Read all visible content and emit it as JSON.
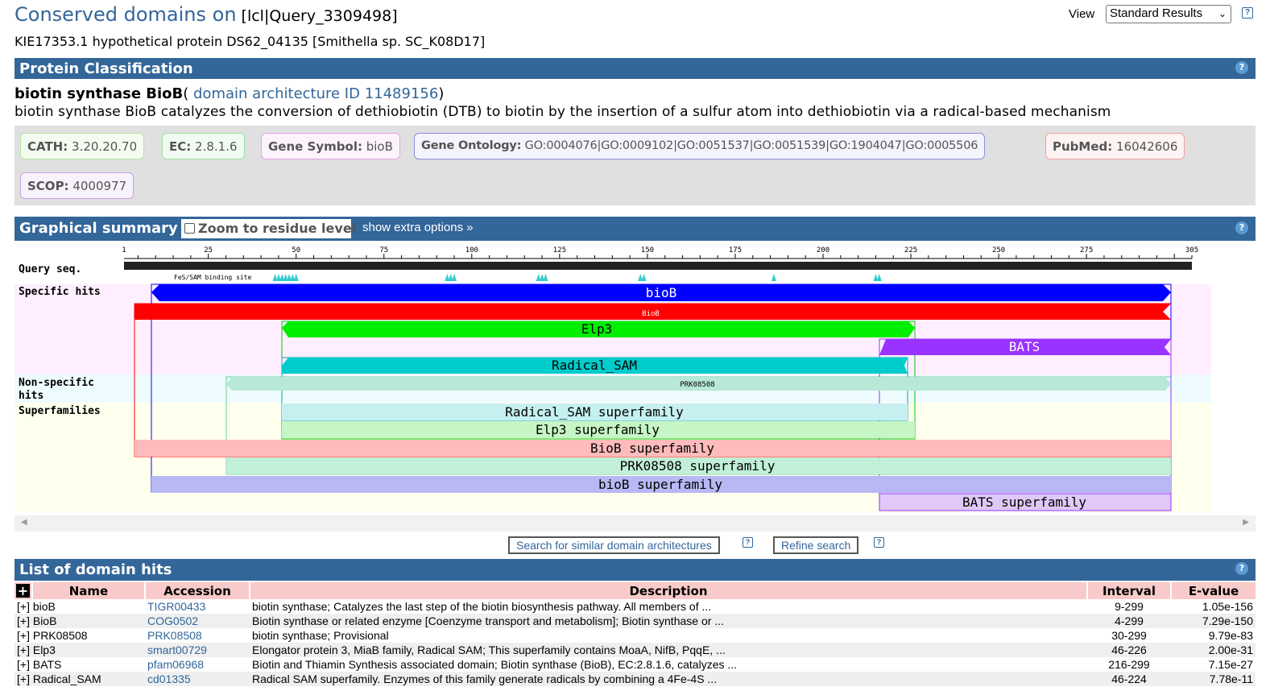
{
  "header": {
    "title": "Conserved domains on",
    "query_id": "[lcl|Query_3309498]",
    "subtitle": "KIE17353.1 hypothetical protein DS62_04135 [Smithella sp. SC_K08D17]",
    "view_label": "View",
    "view_value": "Standard Results",
    "help": "?"
  },
  "classification": {
    "bar_title": "Protein Classification",
    "name": "biotin synthase BioB",
    "arch_prefix": "( ",
    "arch_link": "domain architecture ID 11489156",
    "arch_suffix": ")",
    "description": "biotin synthase BioB catalyzes the conversion of dethiobiotin (DTB) to biotin by the insertion of a sulfur atom into dethiobiotin via a radical-based mechanism",
    "badges": [
      {
        "label": "CATH:",
        "value": "3.20.20.70",
        "border": "#b3e6a1",
        "bg": "#f4fbf0"
      },
      {
        "label": "EC:",
        "value": "2.8.1.6",
        "border": "#9ce39c",
        "bg": "#f2fbf2"
      },
      {
        "label": "Gene Symbol:",
        "value": "bioB",
        "border": "#e6a1e6",
        "bg": "#fdf3fd"
      },
      {
        "label": "Gene Ontology:",
        "value": "GO:0004076|GO:0009102|GO:0051537|GO:0051539|GO:1904047|GO:0005506",
        "border": "#8c8ce6",
        "bg": "#f4f4fd"
      },
      {
        "label": "PubMed:",
        "value": "16042606",
        "border": "#f0a0a0",
        "bg": "#fdf3f3"
      },
      {
        "label": "SCOP:",
        "value": "4000977",
        "border": "#c8a0e6",
        "bg": "#f8f2fd"
      }
    ]
  },
  "graphical": {
    "bar_title": "Graphical summary",
    "zoom_label": "Zoom to residue level",
    "extra_options": "show extra options »",
    "ruler_ticks": [
      "1",
      "25",
      "50",
      "75",
      "100",
      "125",
      "150",
      "175",
      "200",
      "225",
      "250",
      "275",
      "305"
    ],
    "row_labels": {
      "query": "Query seq.",
      "specific": "Specific hits",
      "nonspecific_1": "Non-specific",
      "nonspecific_2": "hits",
      "superfamilies": "Superfamilies"
    },
    "site_label": "FeS/SAM binding site",
    "domains": {
      "bioB": "bioB",
      "BioB": "BioB",
      "Elp3": "Elp3",
      "BATS": "BATS",
      "Radical_SAM": "Radical_SAM",
      "PRK08508": "PRK08508",
      "sf_radical": "Radical_SAM superfamily",
      "sf_elp3": "Elp3 superfamily",
      "sf_biob_cap": "BioB superfamily",
      "sf_prk": "PRK08508 superfamily",
      "sf_biob": "bioB superfamily",
      "sf_bats": "BATS superfamily"
    },
    "colors": {
      "bioB": "#0000ff",
      "BioB": "#ff0000",
      "Elp3": "#00ee00",
      "BATS": "#9933ff",
      "Radical_SAM": "#00cccc",
      "PRK08508": "#b8e8d8",
      "site": "#33cccc"
    }
  },
  "buttons": {
    "search_similar": "Search for similar domain architectures",
    "refine": "Refine search"
  },
  "hits": {
    "bar_title": "List of domain hits",
    "expand_all": "+",
    "columns": [
      "Name",
      "Accession",
      "Description",
      "Interval",
      "E-value"
    ],
    "rows": [
      {
        "name": "bioB",
        "accession": "TIGR00433",
        "description": "biotin synthase; Catalyzes the last step of the biotin biosynthesis pathway. All members of ...",
        "interval": "9-299",
        "evalue": "1.05e-156"
      },
      {
        "name": "BioB",
        "accession": "COG0502",
        "description": "Biotin synthase or related enzyme [Coenzyme transport and metabolism]; Biotin synthase or ...",
        "interval": "4-299",
        "evalue": "7.29e-150"
      },
      {
        "name": "PRK08508",
        "accession": "PRK08508",
        "description": "biotin synthase; Provisional",
        "interval": "30-299",
        "evalue": "9.79e-83"
      },
      {
        "name": "Elp3",
        "accession": "smart00729",
        "description": "Elongator protein 3, MiaB family, Radical SAM; This superfamily contains MoaA, NifB, PqqE, ...",
        "interval": "46-226",
        "evalue": "2.00e-31"
      },
      {
        "name": "BATS",
        "accession": "pfam06968",
        "description": "Biotin and Thiamin Synthesis associated domain; Biotin synthase (BioB), EC:2.8.1.6, catalyzes ...",
        "interval": "216-299",
        "evalue": "7.15e-27"
      },
      {
        "name": "Radical_SAM",
        "accession": "cd01335",
        "description": "Radical SAM superfamily. Enzymes of this family generate radicals by combining a 4Fe-4S ...",
        "interval": "46-224",
        "evalue": "7.78e-11"
      }
    ],
    "row_toggle": "[+]"
  }
}
